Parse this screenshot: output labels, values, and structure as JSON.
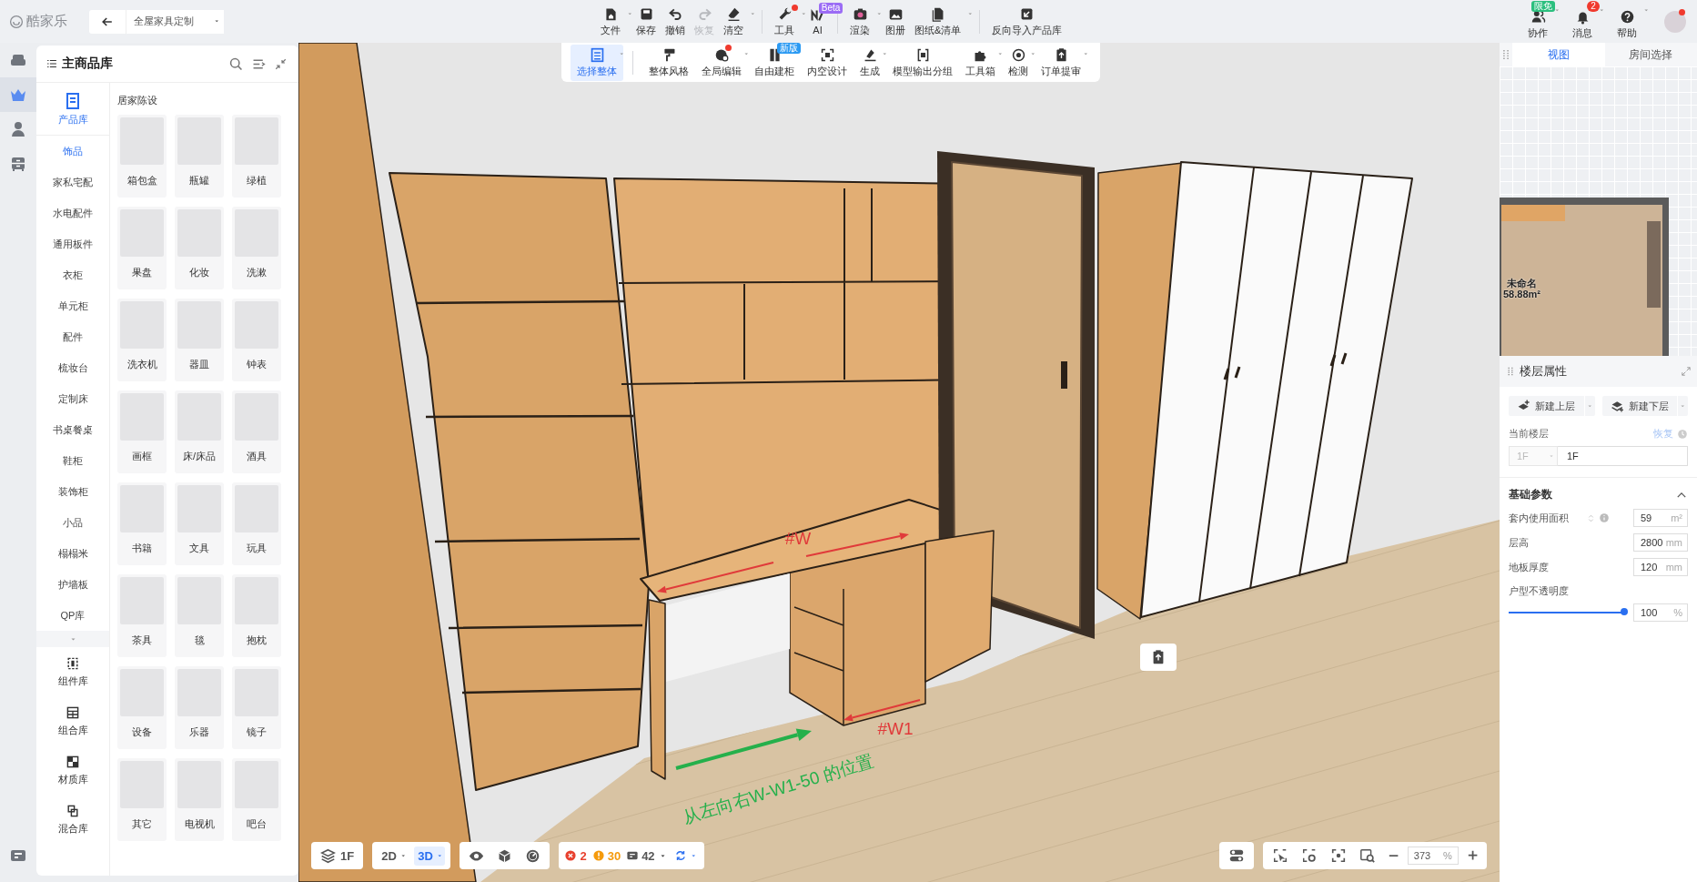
{
  "header": {
    "logo": "酷家乐",
    "mode_select": {
      "value": "全屋家具定制"
    }
  },
  "main_toolbar": {
    "groups": [
      {
        "items": [
          {
            "label": "文件",
            "dropdown": true,
            "disabled": false,
            "dot": false
          },
          {
            "label": "保存",
            "dropdown": false,
            "disabled": false,
            "dot": false
          },
          {
            "label": "撤销",
            "dropdown": false,
            "disabled": false,
            "dot": false
          },
          {
            "label": "恢复",
            "dropdown": false,
            "disabled": true,
            "dot": false
          },
          {
            "label": "清空",
            "dropdown": true,
            "disabled": false,
            "dot": false
          }
        ]
      },
      {
        "items": [
          {
            "label": "工具",
            "dropdown": true,
            "disabled": false,
            "dot": true
          },
          {
            "label": "AI",
            "dropdown": false,
            "disabled": false,
            "dot": false,
            "badge": "Beta"
          }
        ]
      },
      {
        "items": [
          {
            "label": "渲染",
            "dropdown": true,
            "disabled": false,
            "dot": false
          },
          {
            "label": "图册",
            "dropdown": false,
            "disabled": false,
            "dot": false
          },
          {
            "label": "图纸&清单",
            "dropdown": true,
            "disabled": false,
            "dot": false
          }
        ]
      },
      {
        "items": [
          {
            "label": "反向导入产品库",
            "dropdown": false,
            "disabled": false,
            "dot": false
          }
        ]
      }
    ]
  },
  "user_menu": [
    {
      "label": "协作",
      "badge": "限免"
    },
    {
      "label": "消息",
      "badge": "2"
    },
    {
      "label": "帮助"
    }
  ],
  "avatar": {
    "dot": true
  },
  "left_rail": [
    {
      "selected": false
    },
    {
      "selected": true
    },
    {
      "selected": false
    },
    {
      "selected": false
    }
  ],
  "library": {
    "title": "主商品库",
    "tabs": [
      {
        "label": "产品库",
        "selected": true
      }
    ],
    "categories": [
      {
        "label": "饰品",
        "selected": true
      },
      {
        "label": "家私宅配",
        "selected": false
      },
      {
        "label": "水电配件",
        "selected": false
      },
      {
        "label": "通用板件",
        "selected": false
      },
      {
        "label": "衣柜",
        "selected": false
      },
      {
        "label": "单元柜",
        "selected": false
      },
      {
        "label": "配件",
        "selected": false
      },
      {
        "label": "梳妆台",
        "selected": false
      },
      {
        "label": "定制床",
        "selected": false
      },
      {
        "label": "书桌餐桌",
        "selected": false
      },
      {
        "label": "鞋柜",
        "selected": false
      },
      {
        "label": "装饰柜",
        "selected": false
      },
      {
        "label": "小品",
        "selected": false
      },
      {
        "label": "榻榻米",
        "selected": false
      },
      {
        "label": "护墙板",
        "selected": false
      },
      {
        "label": "QP库",
        "selected": false
      }
    ],
    "libraries": [
      {
        "label": "组件库"
      },
      {
        "label": "组合库"
      },
      {
        "label": "材质库"
      },
      {
        "label": "混合库"
      }
    ],
    "section": "居家陈设",
    "products": [
      {
        "label": "箱包盒"
      },
      {
        "label": "瓶罐"
      },
      {
        "label": "绿植"
      },
      {
        "label": "果盘"
      },
      {
        "label": "化妆"
      },
      {
        "label": "洗漱"
      },
      {
        "label": "洗衣机"
      },
      {
        "label": "器皿"
      },
      {
        "label": "钟表"
      },
      {
        "label": "画框"
      },
      {
        "label": "床/床品"
      },
      {
        "label": "酒具"
      },
      {
        "label": "书籍"
      },
      {
        "label": "文具"
      },
      {
        "label": "玩具"
      },
      {
        "label": "茶具"
      },
      {
        "label": "毯"
      },
      {
        "label": "抱枕"
      },
      {
        "label": "设备"
      },
      {
        "label": "乐器"
      },
      {
        "label": "镜子"
      },
      {
        "label": "其它"
      },
      {
        "label": "电视机"
      },
      {
        "label": "吧台"
      }
    ]
  },
  "design_toolbar": {
    "groups": [
      {
        "items": [
          {
            "label": "选择整体",
            "selected": true,
            "dropdown": true,
            "dot": false
          }
        ]
      },
      {
        "items": [
          {
            "label": "整体风格",
            "selected": false,
            "dropdown": false,
            "dot": false
          },
          {
            "label": "全局编辑",
            "selected": false,
            "dropdown": true,
            "dot": true
          },
          {
            "label": "自由建柜",
            "selected": false,
            "dropdown": false,
            "dot": false,
            "badge": "新版"
          },
          {
            "label": "内空设计",
            "selected": false,
            "dropdown": false,
            "dot": false
          },
          {
            "label": "生成",
            "selected": false,
            "dropdown": true,
            "dot": false
          },
          {
            "label": "模型输出分组",
            "selected": false,
            "dropdown": false,
            "dot": false
          },
          {
            "label": "工具箱",
            "selected": false,
            "dropdown": true,
            "dot": false
          },
          {
            "label": "检测",
            "selected": false,
            "dropdown": true,
            "dot": false
          },
          {
            "label": "订单提审",
            "selected": false,
            "dropdown": true,
            "dot": false
          }
        ]
      }
    ]
  },
  "annotations": [
    {
      "kind": "dimension",
      "text": "#W"
    },
    {
      "kind": "dimension",
      "text": "#W1"
    },
    {
      "kind": "direction",
      "text": "从左向右W-W1-50 的位置"
    }
  ],
  "view_toolbar": {
    "floor": "1F",
    "modes": [
      {
        "label": "2D",
        "selected": false
      },
      {
        "label": "3D",
        "selected": true
      }
    ],
    "issues": [
      {
        "kind": "error",
        "count": "2"
      },
      {
        "kind": "warning",
        "count": "30"
      },
      {
        "kind": "info",
        "count": "42"
      }
    ],
    "zoom": {
      "value": "373",
      "unit": "%"
    }
  },
  "view_panel": {
    "tabs": [
      {
        "label": "视图",
        "selected": true
      },
      {
        "label": "房间选择",
        "selected": false
      }
    ],
    "room": {
      "name": "未命名",
      "area": "58.88m²"
    }
  },
  "floor_properties": {
    "title": "楼层属性",
    "actions": [
      {
        "label": "新建上层"
      },
      {
        "label": "新建下层"
      }
    ],
    "current_floor": {
      "label": "当前楼层",
      "reset": "恢复",
      "select": "1F",
      "value": "1F"
    },
    "section": {
      "title": "基础参数",
      "expanded": true,
      "fields": [
        {
          "kind": "input",
          "label": "套内使用面积",
          "info": true,
          "value": "59",
          "unit": "m²"
        },
        {
          "kind": "input",
          "label": "层高",
          "info": false,
          "value": "2800",
          "unit": "mm"
        },
        {
          "kind": "input",
          "label": "地板厚度",
          "info": false,
          "value": "120",
          "unit": "mm"
        },
        {
          "kind": "slider",
          "label": "户型不透明度",
          "info": false,
          "level": 1,
          "value": "100",
          "unit": "%"
        }
      ]
    }
  }
}
